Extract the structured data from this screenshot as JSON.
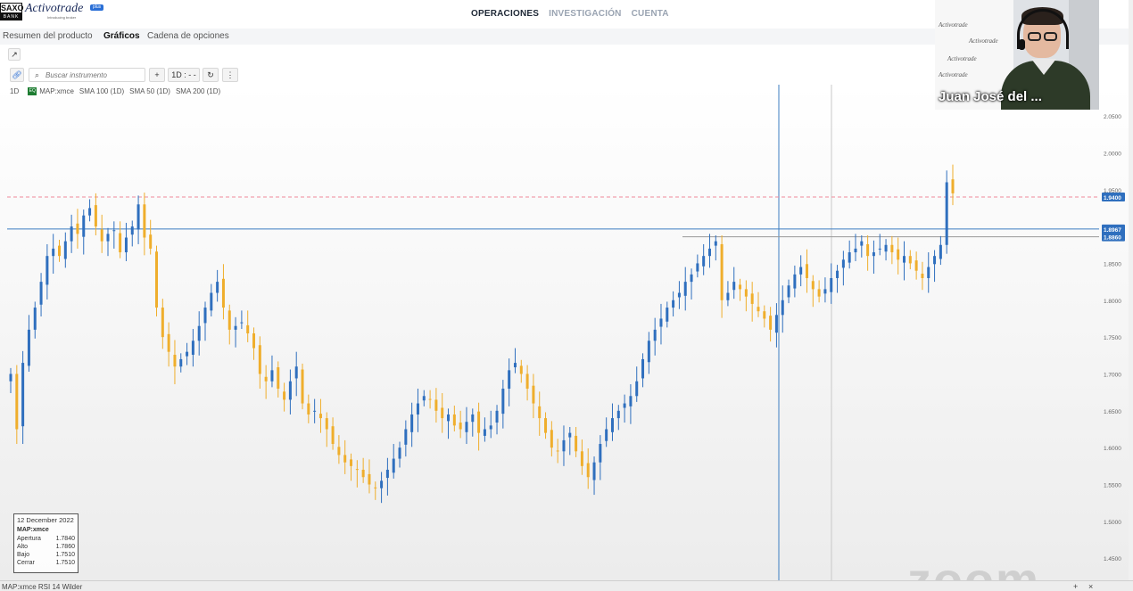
{
  "brand": {
    "saxo": "SAXO",
    "bank": "BANK",
    "name": "Activotrade",
    "plus": "plus",
    "tagline": "Introducing broker"
  },
  "main_nav": [
    {
      "label": "OPERACIONES",
      "active": true
    },
    {
      "label": "INVESTIGACIÓN",
      "active": false
    },
    {
      "label": "CUENTA",
      "active": false
    }
  ],
  "sub_nav": [
    {
      "label": "Resumen del producto",
      "active": false
    },
    {
      "label": "Gráficos",
      "active": true
    },
    {
      "label": "Cadena de opciones",
      "active": false
    }
  ],
  "toolbar": {
    "search_placeholder": "Buscar instrumento",
    "add_label": "+",
    "timeframe_label": "1D : - -",
    "refresh_icon": "refresh-icon",
    "more_icon": "more-vertical-icon",
    "link_icon": "link-icon",
    "popout_icon": "external-link-icon"
  },
  "legend": {
    "period": "1D",
    "badge": "EQ",
    "symbol": "MAP:xmce",
    "indicators": [
      "SMA 100 (1D)",
      "SMA 50 (1D)",
      "SMA 200 (1D)"
    ]
  },
  "ohlc": {
    "date": "12 December 2022",
    "symbol": "MAP:xmce",
    "rows": [
      {
        "label": "Apertura",
        "value": "1.7840"
      },
      {
        "label": "Alto",
        "value": "1.7860"
      },
      {
        "label": "Bajo",
        "value": "1.7510"
      },
      {
        "label": "Cerrar",
        "value": "1.7510"
      }
    ]
  },
  "bottom": {
    "indicator_label": "MAP:xmce RSI 14 Wilder",
    "plus": "+",
    "close": "×"
  },
  "watermark": "zoom",
  "webcam": {
    "name": "Juan José del ...",
    "banner_text": "Activotrade"
  },
  "chart_data": {
    "type": "candlestick",
    "symbol": "MAP:xmce",
    "ylim": [
      1.42,
      2.09
    ],
    "y_ticks": [
      "2.0500",
      "2.0000",
      "1.9500",
      "1.9000",
      "1.8500",
      "1.8000",
      "1.7500",
      "1.7000",
      "1.6500",
      "1.6000",
      "1.5500",
      "1.5000",
      "1.4500"
    ],
    "price_labels": [
      {
        "value": 1.94,
        "text": "1.9400",
        "style": "dashed-pink"
      },
      {
        "value": 1.8967,
        "text": "1.8967",
        "style": "solid-blue"
      },
      {
        "value": 1.886,
        "text": "1.8860",
        "style": "solid-gray"
      }
    ],
    "up_color": "#2f6fbe",
    "down_color": "#efae2c",
    "closes": [
      1.7,
      1.625,
      1.715,
      1.76,
      1.79,
      1.825,
      1.86,
      1.87,
      1.86,
      1.88,
      1.9,
      1.89,
      1.915,
      1.925,
      1.9,
      1.88,
      1.89,
      1.895,
      1.865,
      1.885,
      1.9,
      1.93,
      1.885,
      1.87,
      1.79,
      1.75,
      1.73,
      1.71,
      1.72,
      1.73,
      1.745,
      1.765,
      1.79,
      1.81,
      1.825,
      1.79,
      1.76,
      1.765,
      1.77,
      1.755,
      1.735,
      1.7,
      1.69,
      1.705,
      1.68,
      1.665,
      1.69,
      1.71,
      1.66,
      1.645,
      1.65,
      1.64,
      1.625,
      1.605,
      1.59,
      1.58,
      1.575,
      1.57,
      1.56,
      1.55,
      1.545,
      1.555,
      1.57,
      1.585,
      1.6,
      1.625,
      1.645,
      1.66,
      1.67,
      1.665,
      1.65,
      1.64,
      1.645,
      1.63,
      1.625,
      1.635,
      1.645,
      1.62,
      1.625,
      1.63,
      1.65,
      1.68,
      1.705,
      1.715,
      1.7,
      1.68,
      1.66,
      1.64,
      1.62,
      1.6,
      1.595,
      1.61,
      1.62,
      1.595,
      1.575,
      1.56,
      1.58,
      1.605,
      1.625,
      1.64,
      1.65,
      1.66,
      1.67,
      1.69,
      1.72,
      1.745,
      1.76,
      1.775,
      1.79,
      1.8,
      1.81,
      1.825,
      1.835,
      1.85,
      1.86,
      1.87,
      1.88,
      1.8,
      1.81,
      1.825,
      1.815,
      1.805,
      1.795,
      1.785,
      1.775,
      1.76,
      1.78,
      1.8,
      1.82,
      1.835,
      1.845,
      1.83,
      1.815,
      1.805,
      1.815,
      1.83,
      1.84,
      1.855,
      1.865,
      1.87,
      1.88,
      1.86,
      1.865,
      1.87,
      1.875,
      1.865,
      1.855,
      1.86,
      1.85,
      1.84,
      1.83,
      1.845,
      1.86,
      1.875,
      1.96,
      1.945
    ]
  }
}
